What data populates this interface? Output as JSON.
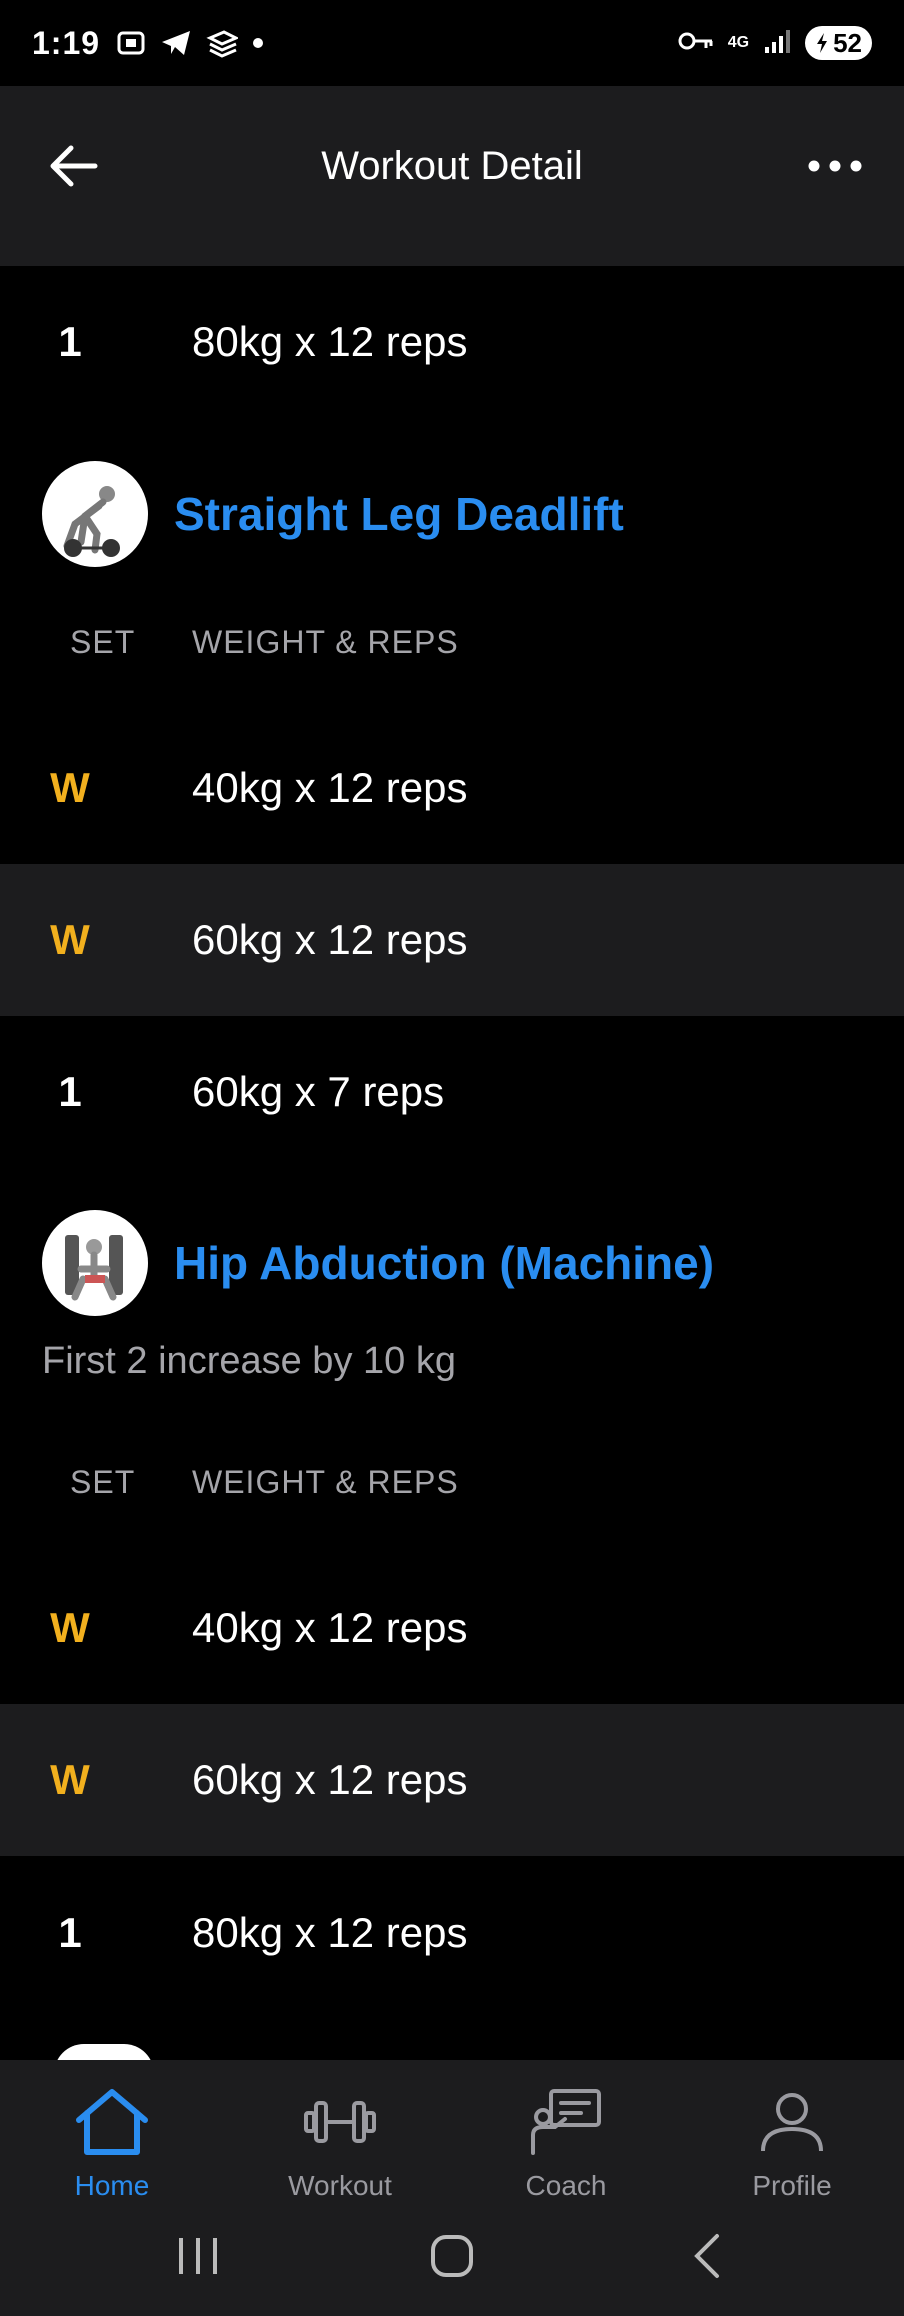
{
  "status": {
    "time": "1:19",
    "network": "4G",
    "battery": "52"
  },
  "header": {
    "title": "Workout Detail"
  },
  "colors": {
    "accent": "#2a8df0",
    "warmup": "#f2b01e",
    "surface": "#1c1c1e",
    "background": "#000000",
    "muted": "#a5a5aa"
  },
  "top_row": {
    "set": "1",
    "weight": "80kg x 12 reps"
  },
  "exercises": [
    {
      "name": "Straight Leg Deadlift",
      "note": "",
      "col_set": "SET",
      "col_weight": "WEIGHT & REPS",
      "sets": [
        {
          "set": "W",
          "weight": "40kg x 12 reps"
        },
        {
          "set": "W",
          "weight": "60kg x 12 reps"
        },
        {
          "set": "1",
          "weight": "60kg x 7 reps"
        }
      ]
    },
    {
      "name": "Hip Abduction (Machine)",
      "note": "First 2 increase by 10 kg",
      "col_set": "SET",
      "col_weight": "WEIGHT & REPS",
      "sets": [
        {
          "set": "W",
          "weight": "40kg x 12 reps"
        },
        {
          "set": "W",
          "weight": "60kg x 12 reps"
        },
        {
          "set": "1",
          "weight": "80kg x 12 reps"
        }
      ]
    }
  ],
  "bottom_nav": [
    {
      "label": "Home",
      "icon": "home-icon",
      "active": true
    },
    {
      "label": "Workout",
      "icon": "dumbbell-icon",
      "active": false
    },
    {
      "label": "Coach",
      "icon": "coach-icon",
      "active": false
    },
    {
      "label": "Profile",
      "icon": "profile-icon",
      "active": false
    }
  ]
}
